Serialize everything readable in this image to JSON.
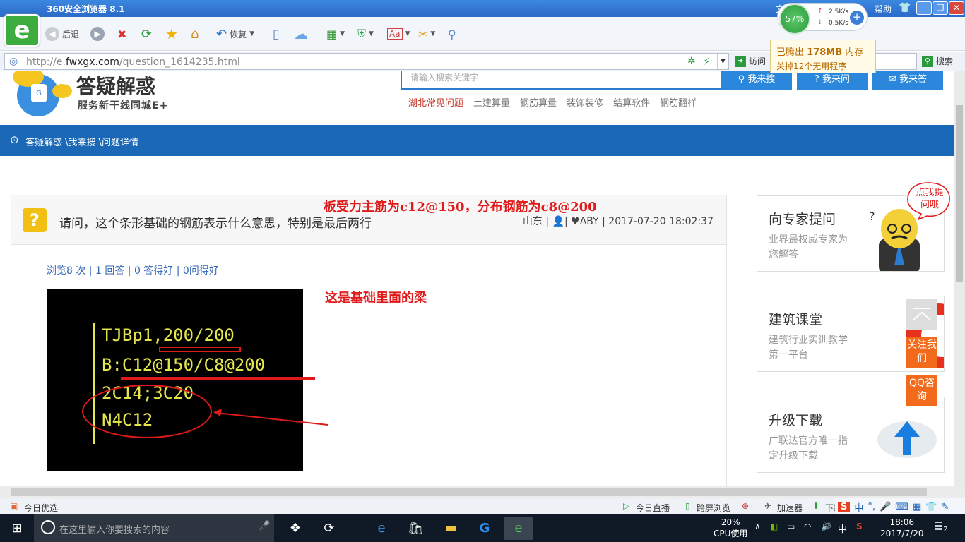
{
  "browser": {
    "title": "360安全浏览器 8.1",
    "menu": [
      "文",
      "帮助"
    ],
    "back_label": "后退",
    "restore_label": "恢复",
    "url_prefix": "http://e.",
    "url_domain": "fwxgx.com",
    "url_path": "/question_1614235.html",
    "visit_label": "访问",
    "search_label": "搜索",
    "net": {
      "percent": "57%",
      "up": "2.5K/s",
      "down": "0.5K/s"
    },
    "tip": {
      "line1_prefix": "已腾出 ",
      "line1_value": "178MB",
      "line1_suffix": " 内存",
      "line2": "关掉12个无用程序"
    }
  },
  "site": {
    "brand": "答疑解惑",
    "slogan": "服务新干线同城E+",
    "search_placeholder": "请输入搜索关键字",
    "buttons": [
      "我来搜",
      "我来问",
      "我来答"
    ],
    "categories": [
      "湖北常见问题",
      "土建算量",
      "钢筋算量",
      "装饰装修",
      "结算软件",
      "钢筋翻样"
    ],
    "breadcrumb": "答疑解惑 \\我来搜 \\问题详情"
  },
  "question": {
    "title": "请问，这个条形基础的钢筋表示什么意思，特别是最后两行",
    "location": "山东",
    "user": "ABY",
    "time": "2017-07-20 18:02:37",
    "stats": "浏览8 次 | 1 回答 | 0 答得好 | 0问得好",
    "image_lines": [
      "TJBp1,200/200",
      "B:C12@150/C8@200",
      "2C14;3C20",
      "N4C12"
    ],
    "annotation1": "板受力主筋为c12@150，分布钢筋为c8@200",
    "annotation2": "这是基础里面的梁"
  },
  "sidebar": {
    "cards": [
      {
        "title": "向专家提问",
        "desc": "业界最权威专家为您解答"
      },
      {
        "title": "建筑课堂",
        "desc": "建筑行业实训教学第一平台"
      },
      {
        "title": "升级下载",
        "desc": "广联达官方唯一指定升级下载"
      }
    ],
    "bubble": "点我提问哦",
    "follow": "关注我们",
    "qq": "QQ咨询"
  },
  "statusbar": {
    "left": "今日优选",
    "items": [
      "今日直播",
      "跨屏浏览",
      "加速器",
      "下载"
    ]
  },
  "taskbar": {
    "search_placeholder": "在这里输入你要搜索的内容",
    "cpu_percent": "20%",
    "cpu_label": "CPU使用",
    "ime": "中",
    "time": "18:06",
    "date": "2017/7/20",
    "notifications": "2"
  },
  "colors": {
    "accent": "#1a68b6",
    "brand_green": "#3dac3f",
    "annotation_red": "#e01a1a",
    "cad_yellow": "#e5e54d"
  }
}
